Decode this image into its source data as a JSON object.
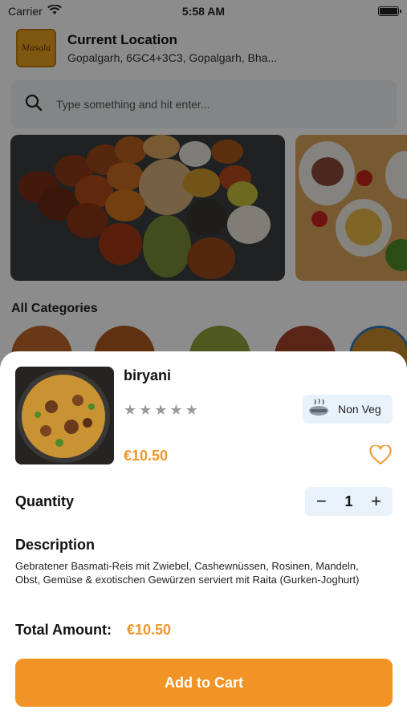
{
  "status_bar": {
    "carrier": "Carrier",
    "time": "5:58 AM",
    "battery_level": 0.9
  },
  "header": {
    "logo_text": "Masala",
    "location_title": "Current Location",
    "location_address": "Gopalgarh, 6GC4+3C3, Gopalgarh, Bha..."
  },
  "search": {
    "placeholder": "Type something and hit enter...",
    "icon": "search-icon"
  },
  "categories": {
    "title": "All Categories"
  },
  "item": {
    "name": "biryani",
    "rating": 0,
    "rating_max": 5,
    "star_glyph": "★",
    "veg_label": "Non Veg",
    "price": "€10.50",
    "icon_favorite": "heart-icon"
  },
  "quantity": {
    "label": "Quantity",
    "minus": "−",
    "value": "1",
    "plus": "+"
  },
  "description": {
    "label": "Description",
    "text": "Gebratener Basmati-Reis mit Zwiebel, Cashewnüssen, Rosinen, Mandeln, Obst, Gemüse & exotischen Gewürzen serviert mit Raita (Gurken-Joghurt)"
  },
  "total": {
    "label": "Total Amount:",
    "value": "€10.50"
  },
  "cart_button": {
    "label": "Add to Cart"
  },
  "colors": {
    "accent": "#f29425",
    "badge_bg": "#e9f1fb",
    "overlay": "rgba(0,0,0,0.45)"
  }
}
